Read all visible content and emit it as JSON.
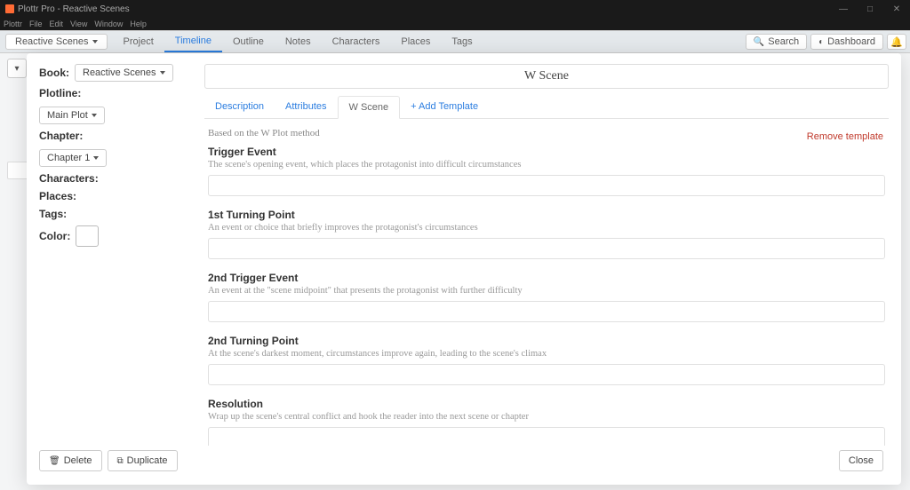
{
  "window": {
    "title": "Plottr Pro - Reactive Scenes",
    "menus": [
      "Plottr",
      "File",
      "Edit",
      "View",
      "Window",
      "Help"
    ]
  },
  "toolbar": {
    "file_dropdown": "Reactive Scenes",
    "nav": {
      "project": "Project",
      "timeline": "Timeline",
      "outline": "Outline",
      "notes": "Notes",
      "characters": "Characters",
      "places": "Places",
      "tags": "Tags"
    },
    "search": "Search",
    "dashboard": "Dashboard"
  },
  "sidebar": {
    "book_label": "Book:",
    "book_value": "Reactive Scenes",
    "plotline_label": "Plotline:",
    "plotline_value": "Main Plot",
    "chapter_label": "Chapter:",
    "chapter_value": "Chapter 1",
    "characters_label": "Characters:",
    "places_label": "Places:",
    "tags_label": "Tags:",
    "color_label": "Color:"
  },
  "scene": {
    "title": "W Scene",
    "tabs": {
      "description": "Description",
      "attributes": "Attributes",
      "wscene": "W Scene",
      "add_template": "+ Add Template"
    },
    "method_note": "Based on the W Plot method",
    "remove_template": "Remove template",
    "fields": [
      {
        "title": "Trigger Event",
        "desc": "The scene's opening event, which places the protagonist into difficult circumstances"
      },
      {
        "title": "1st Turning Point",
        "desc": "An event or choice that briefly improves the protagonist's circumstances"
      },
      {
        "title": "2nd Trigger Event",
        "desc": "An event at the \"scene midpoint\" that presents the protagonist with further difficulty"
      },
      {
        "title": "2nd Turning Point",
        "desc": "At the scene's darkest moment, circumstances improve again, leading to the scene's climax"
      },
      {
        "title": "Resolution",
        "desc": "Wrap up the scene's central conflict and hook the reader into the next scene or chapter"
      }
    ]
  },
  "footer": {
    "delete": "Delete",
    "duplicate": "Duplicate",
    "close": "Close"
  }
}
